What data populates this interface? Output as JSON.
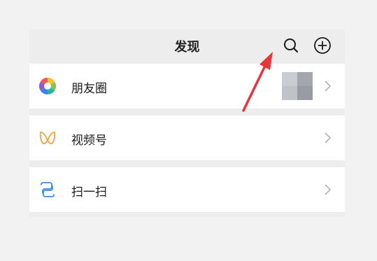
{
  "header": {
    "title": "发现",
    "search_icon": "search-icon",
    "add_icon": "plus-circle-icon"
  },
  "rows": [
    {
      "label": "朋友圈",
      "icon": "moments-shutter-icon"
    },
    {
      "label": "视频号",
      "icon": "channels-butterfly-icon"
    },
    {
      "label": "扫一扫",
      "icon": "scan-icon"
    }
  ],
  "colors": {
    "background": "#f2f2f2",
    "header_bg": "#ededed",
    "row_bg": "#ffffff",
    "arrow": "#e8343a",
    "chevron": "#b2b2b2",
    "channels": "#f5a23c",
    "scan": "#3b8fe8"
  }
}
